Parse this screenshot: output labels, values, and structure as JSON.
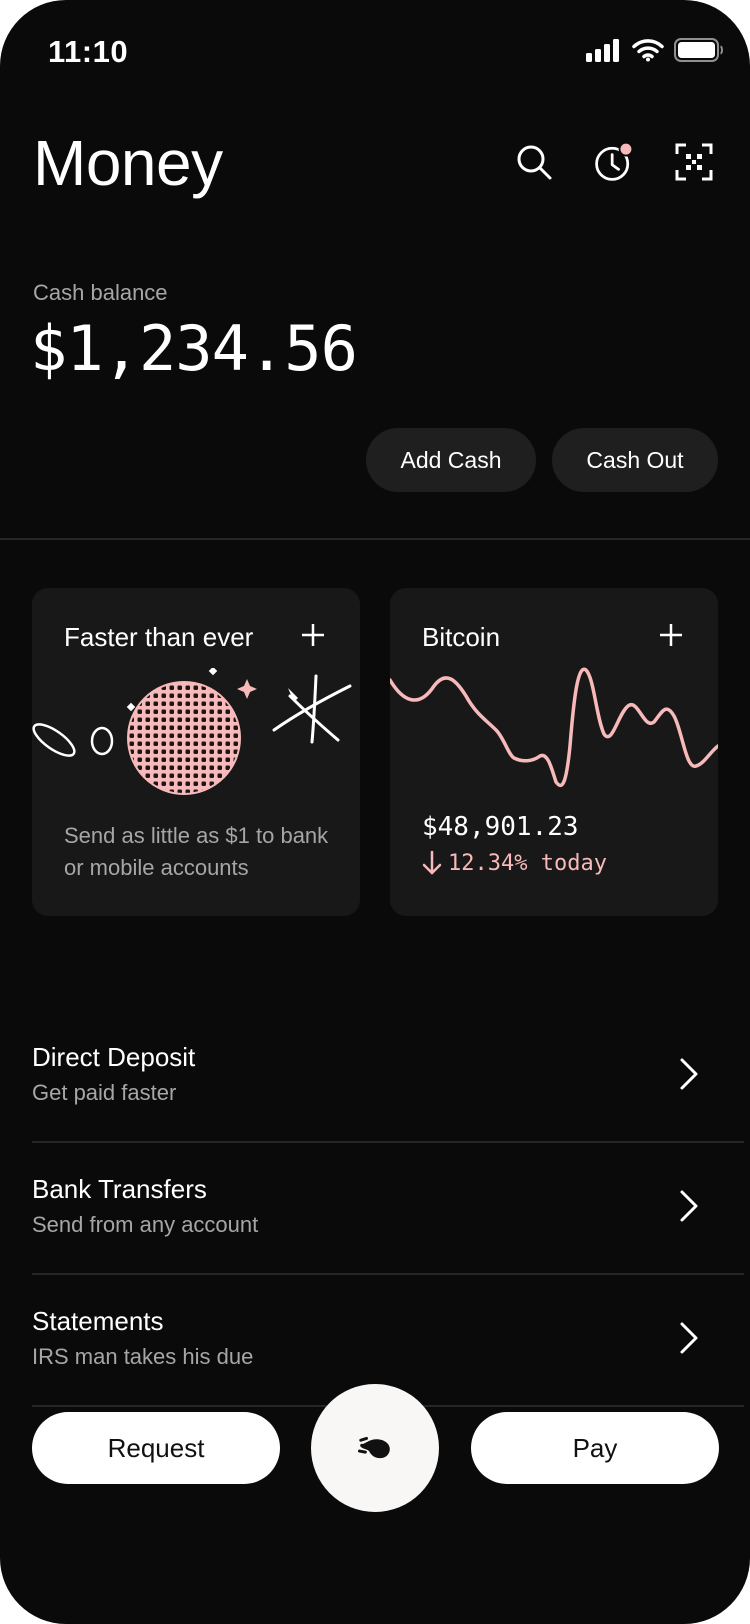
{
  "status_bar": {
    "time": "11:10"
  },
  "header": {
    "title": "Money"
  },
  "balance": {
    "label": "Cash balance",
    "amount": "$1,234.56"
  },
  "actions": {
    "add_cash": "Add Cash",
    "cash_out": "Cash Out"
  },
  "cards": {
    "promo": {
      "title": "Faster than ever",
      "text": "Send as little as $1 to bank or mobile accounts"
    },
    "bitcoin": {
      "title": "Bitcoin",
      "price": "$48,901.23",
      "change": "12.34% today",
      "direction": "down"
    }
  },
  "list": [
    {
      "title": "Direct Deposit",
      "subtitle": "Get paid faster"
    },
    {
      "title": "Bank Transfers",
      "subtitle": "Send from any account"
    },
    {
      "title": "Statements",
      "subtitle": "IRS man takes his due"
    }
  ],
  "bottom": {
    "request": "Request",
    "pay": "Pay"
  },
  "colors": {
    "background": "#0a0a0a",
    "card": "#181818",
    "accent_pink": "#f7b9b9",
    "muted_text": "#a6a6a6"
  }
}
